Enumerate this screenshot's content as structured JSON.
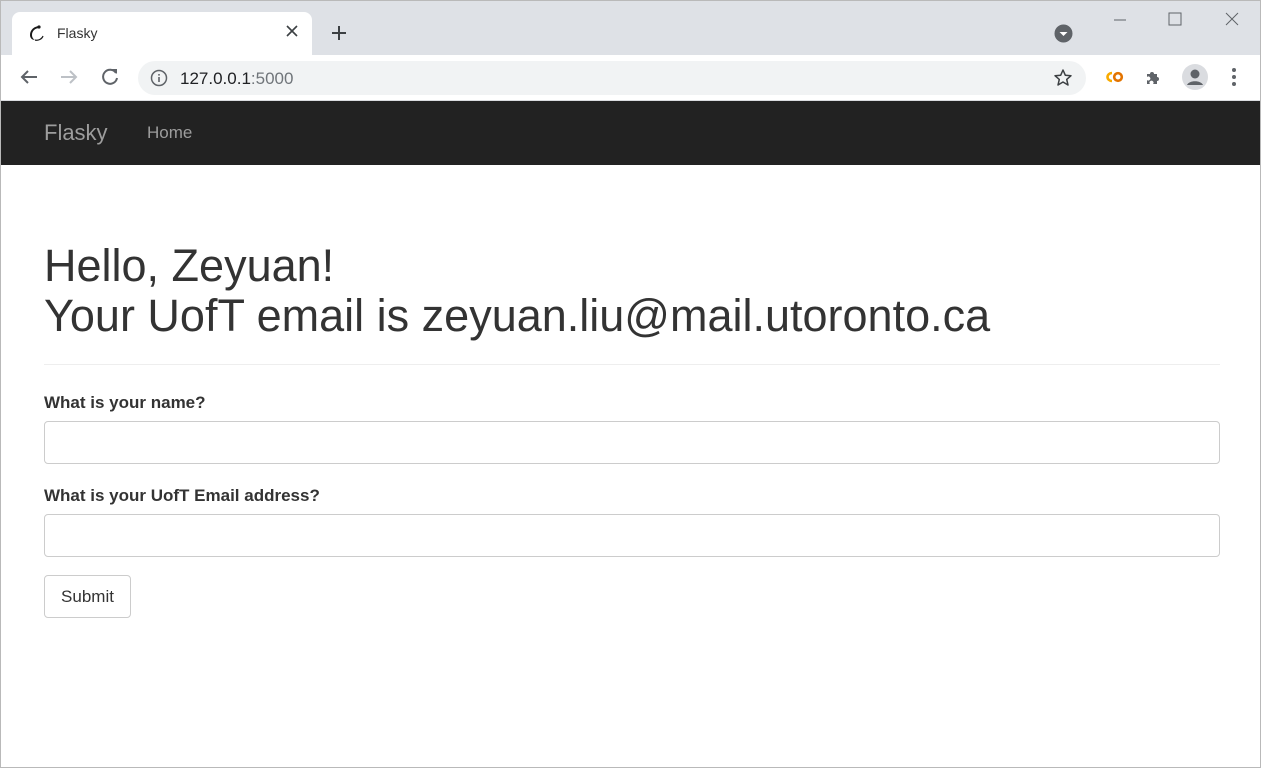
{
  "browser": {
    "tab_title": "Flasky",
    "url_host": "127.0.0.1",
    "url_port": ":5000"
  },
  "navbar": {
    "brand": "Flasky",
    "links": [
      {
        "label": "Home"
      }
    ]
  },
  "greeting": {
    "line1": "Hello, Zeyuan!",
    "line2": "Your UofT email is zeyuan.liu@mail.utoronto.ca"
  },
  "form": {
    "name_label": "What is your name?",
    "name_value": "",
    "email_label": "What is your UofT Email address?",
    "email_value": "",
    "submit_label": "Submit"
  },
  "colors": {
    "navbar_bg": "#222222",
    "navbar_text": "#9d9d9d",
    "text": "#333333",
    "tabstrip_bg": "#dee1e6"
  },
  "icons": {
    "favicon": "flask-horn-icon",
    "tab_close": "close-icon",
    "new_tab": "plus-icon",
    "tab_search": "tab-search-icon",
    "back": "back-arrow-icon",
    "forward": "forward-arrow-icon",
    "reload": "reload-icon",
    "site_info": "info-icon",
    "bookmark": "star-icon",
    "extension_co": "colab-icon",
    "extensions": "puzzle-icon",
    "profile": "avatar-icon",
    "menu": "kebab-menu-icon"
  }
}
